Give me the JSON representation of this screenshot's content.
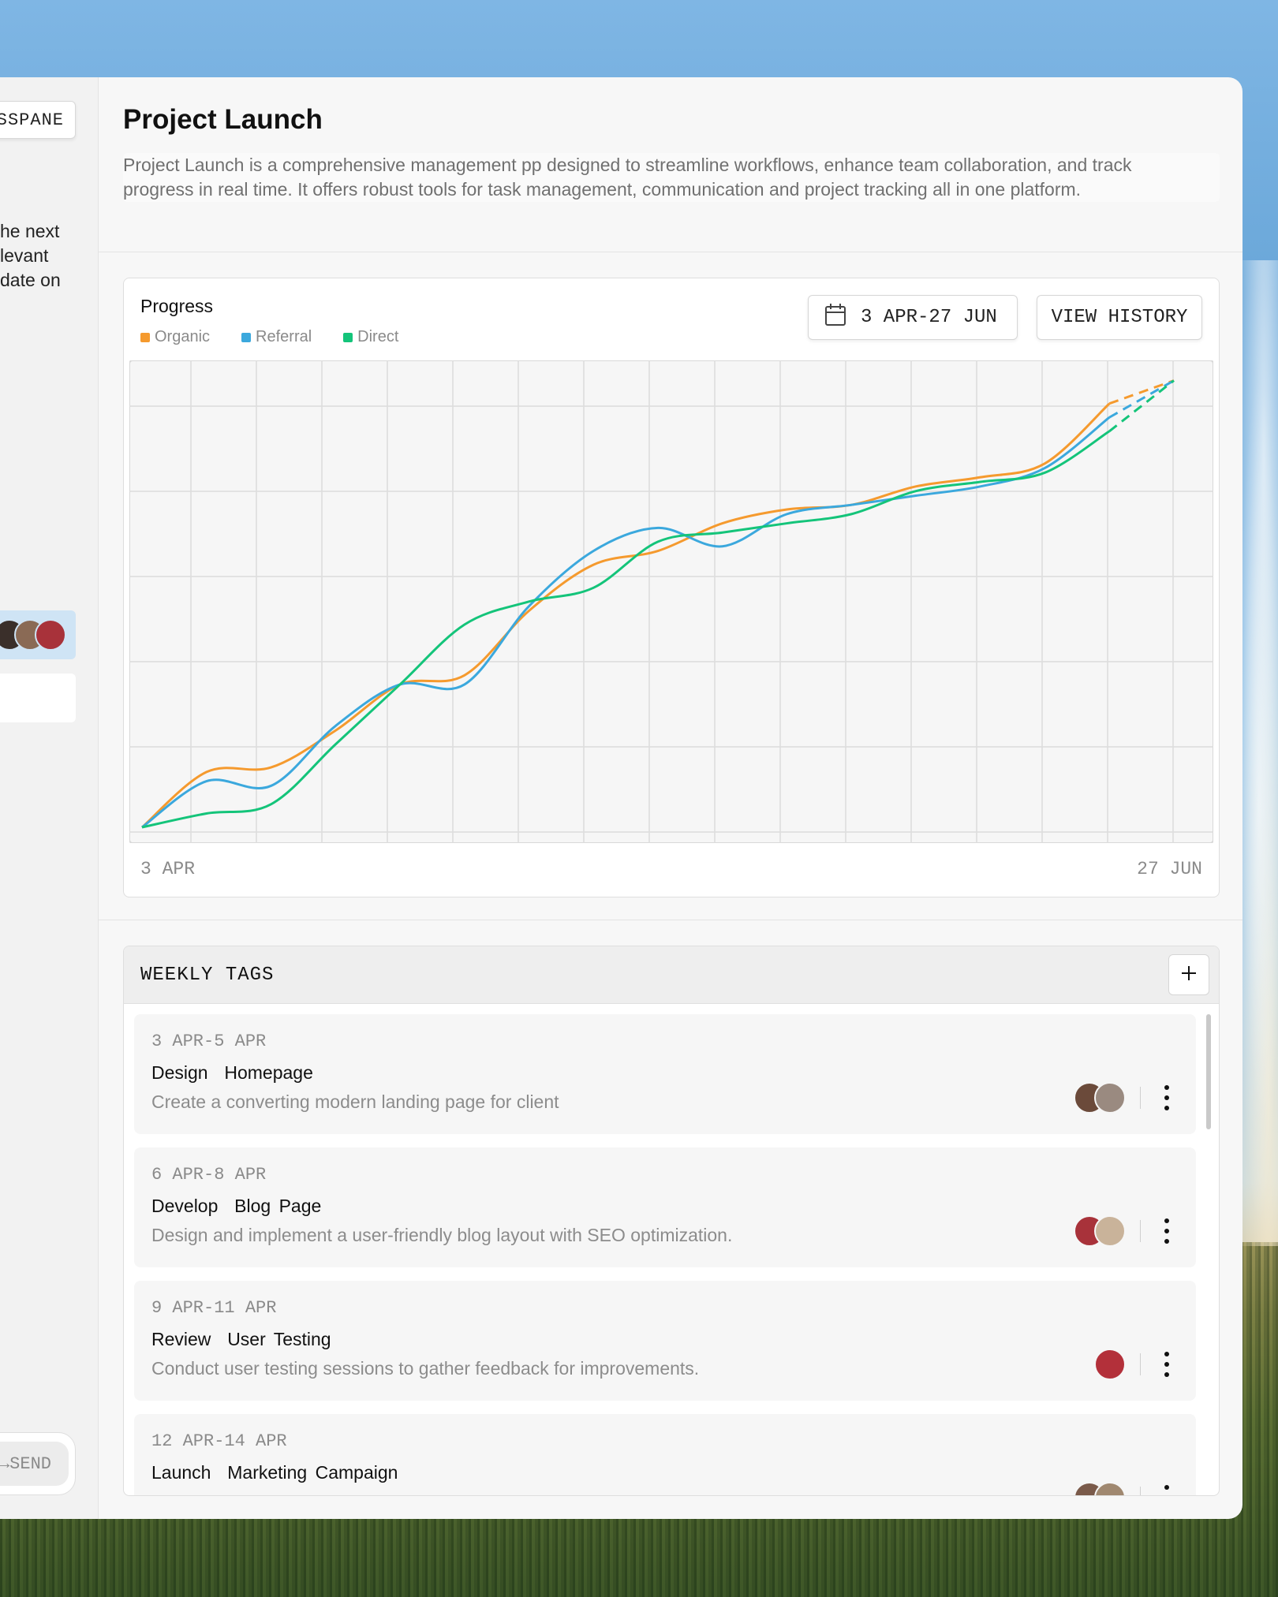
{
  "left_panel": {
    "collapse_label": "SSPANE",
    "text_lines": [
      "he next",
      "levant",
      "date on"
    ],
    "send_label": "→SEND"
  },
  "project": {
    "title": "Project Launch",
    "description": "Project Launch is a comprehensive management pp designed to streamline workflows, enhance team collaboration, and track progress in real time. It offers robust tools for task management, communication and project tracking all in one platform."
  },
  "progress": {
    "title": "Progress",
    "date_range": "3 APR-27 JUN",
    "view_history_label": "VIEW HISTORY",
    "x_start": "3 APR",
    "x_end": "27 JUN",
    "legend": [
      {
        "name": "Organic",
        "color": "#f59a2e"
      },
      {
        "name": "Referral",
        "color": "#3ba8dd"
      },
      {
        "name": "Direct",
        "color": "#14c47a"
      }
    ]
  },
  "chart_data": {
    "type": "line",
    "x": [
      0,
      1,
      2,
      3,
      4,
      5,
      6,
      7,
      8,
      9,
      10,
      11,
      12,
      13,
      14,
      15,
      16
    ],
    "series": [
      {
        "name": "Organic",
        "values": [
          0,
          12,
          13,
          21,
          31,
          33,
          47,
          57,
          60,
          66,
          69,
          70,
          74,
          76,
          79,
          92,
          97
        ]
      },
      {
        "name": "Referral",
        "values": [
          0,
          10,
          9,
          22,
          31,
          31,
          48,
          60,
          65,
          61,
          68,
          70,
          72,
          74,
          78,
          89,
          97
        ]
      },
      {
        "name": "Direct",
        "values": [
          0,
          3,
          5,
          18,
          31,
          44,
          49,
          52,
          62,
          64,
          66,
          68,
          73,
          75,
          77,
          86,
          97
        ]
      }
    ],
    "projected_from_index": 15,
    "ylim": [
      0,
      100
    ],
    "grid": true,
    "legend_position": "top-left"
  },
  "weekly_tags": {
    "title": "WEEKLY TAGS",
    "items": [
      {
        "date": "3 APR-5 APR",
        "name": "Design  Homepage",
        "description": "Create a converting modern landing page for client",
        "avatars": [
          "#6b4a3a",
          "#9a8a80"
        ]
      },
      {
        "date": "6 APR-8 APR",
        "name": "Develop  Blog Page",
        "description": "Design and implement a user-friendly blog layout with SEO optimization.",
        "avatars": [
          "#a8323a",
          "#c9b39a"
        ]
      },
      {
        "date": "9 APR-11 APR",
        "name": "Review  User Testing",
        "description": "Conduct user testing sessions to gather feedback for improvements.",
        "avatars": [
          "#b3303a"
        ]
      },
      {
        "date": "12 APR-14 APR",
        "name": "Launch  Marketing Campaign",
        "description": "",
        "avatars": [
          "#7a5a4a",
          "#a08870"
        ]
      }
    ]
  }
}
